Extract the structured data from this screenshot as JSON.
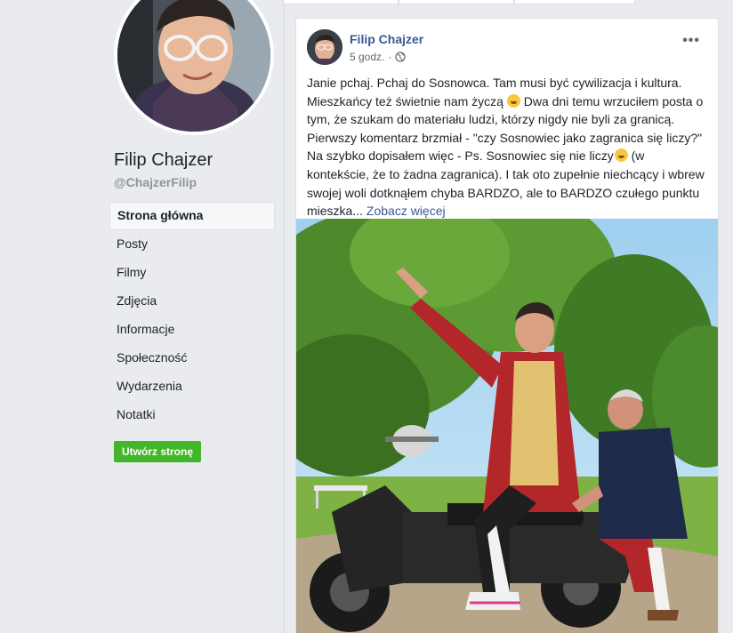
{
  "page": {
    "name": "Filip Chajzer",
    "handle": "@ChajzerFilip"
  },
  "nav": {
    "items": [
      {
        "label": "Strona główna",
        "active": true
      },
      {
        "label": "Posty"
      },
      {
        "label": "Filmy"
      },
      {
        "label": "Zdjęcia"
      },
      {
        "label": "Informacje"
      },
      {
        "label": "Społeczność"
      },
      {
        "label": "Wydarzenia"
      },
      {
        "label": "Notatki"
      }
    ],
    "create_page_label": "Utwórz stronę"
  },
  "post": {
    "author": "Filip Chajzer",
    "time": "5 godz.",
    "privacy_icon": "globe-icon",
    "more_icon": "more-options-icon",
    "text_1": "Janie pchaj. Pchaj do Sosnowca. Tam musi być cywilizacja i kultura. Mieszkańcy też świetnie nam życzą",
    "text_2": "Dwa dni temu wrzuciłem posta o tym, że szukam do materiału ludzi, którzy nigdy nie byli za granicą. Pierwszy komentarz brzmiał - \"czy Sosnowiec jako zagranica się liczy?\" Na szybko dopisałem więc - Ps. Sosnowiec się nie liczy",
    "text_3": "(w kontekście, że to żadna zagranica). I tak oto zupełnie niechcący i wbrew swojej woli dotknąłem chyba BARDZO, ale to BARDZO czułego punktu mieszka...",
    "see_more": "Zobacz więcej"
  },
  "colors": {
    "link": "#385898",
    "create_button": "#42b72a",
    "background": "#e9ebee"
  }
}
